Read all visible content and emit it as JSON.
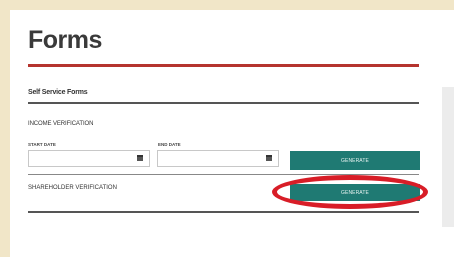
{
  "page": {
    "title": "Forms",
    "accent_color": "#b5342e",
    "button_color": "#1f7a73",
    "highlight_color": "#d81d27"
  },
  "self_service": {
    "heading": "Self Service Forms",
    "income": {
      "heading": "INCOME VERIFICATION",
      "start_label": "START DATE",
      "end_label": "END DATE",
      "start_value": "",
      "end_value": "",
      "generate_label": "GENERATE"
    },
    "shareholder": {
      "heading": "SHAREHOLDER VERIFICATION",
      "generate_label": "GENERATE"
    }
  }
}
